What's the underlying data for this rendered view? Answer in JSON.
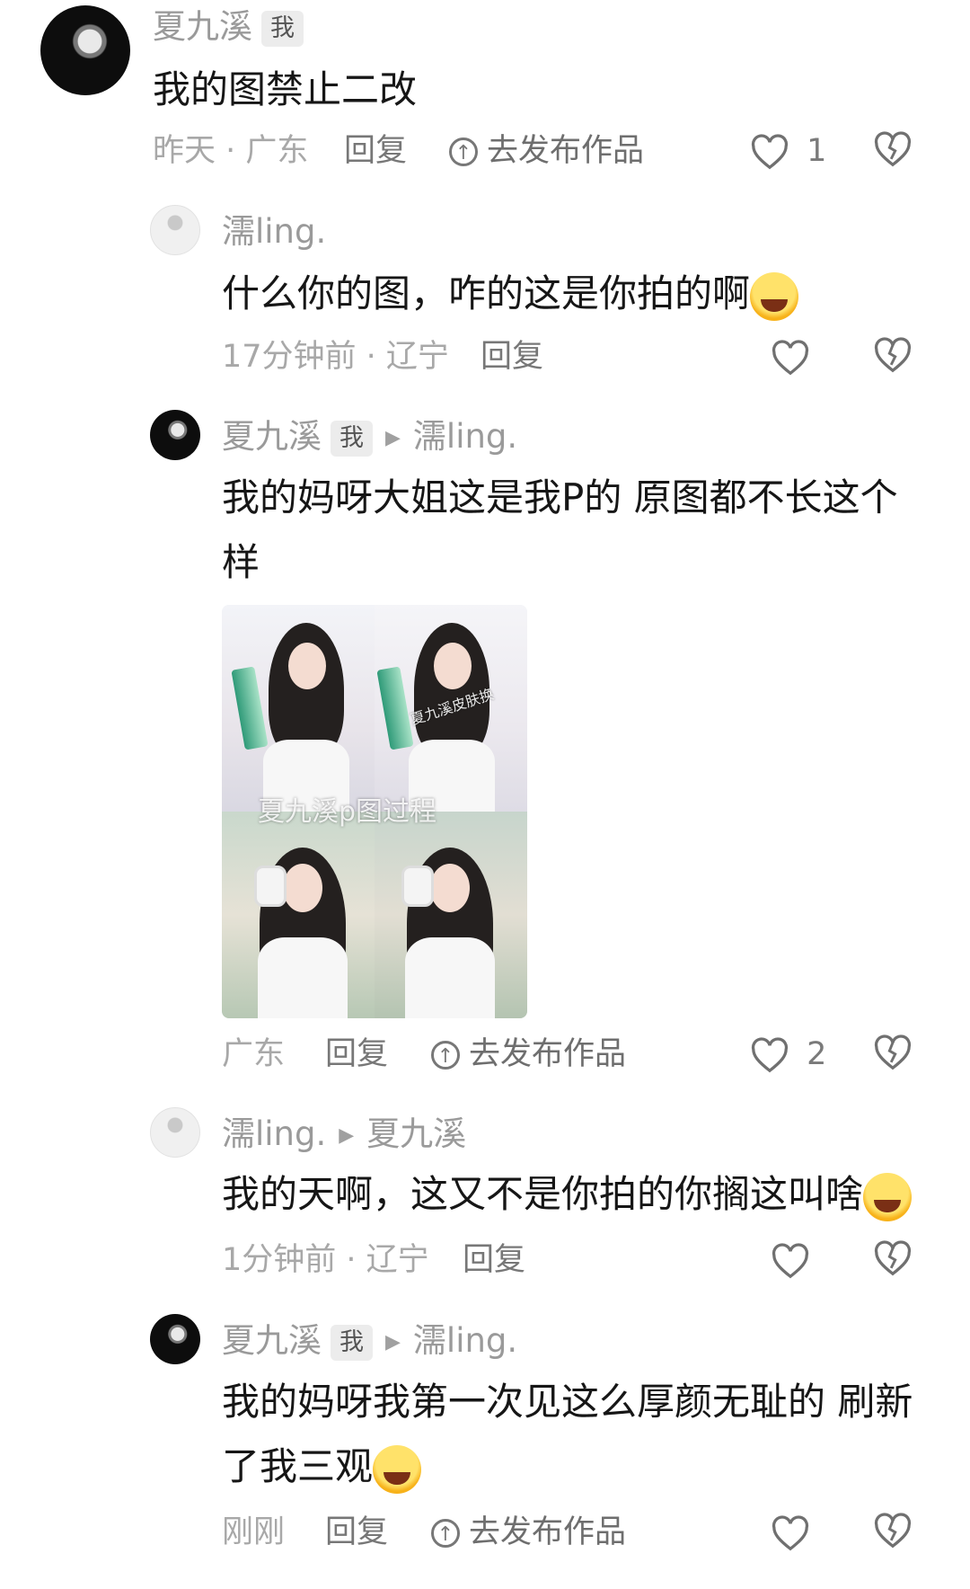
{
  "comments": [
    {
      "username": "夏九溪",
      "badge": "我",
      "text_lines": [
        "我的图禁止二改"
      ],
      "meta": "昨天 · 广东",
      "reply_label": "回复",
      "publish_label": "去发布作品",
      "like_count": "1"
    },
    {
      "username": "濡ling.",
      "text_lines": [
        "什么你的图，咋的这是你拍的啊"
      ],
      "meta": "17分钟前 · 辽宁",
      "reply_label": "回复",
      "emoji": "laughing-crying-emoji"
    },
    {
      "username": "夏九溪",
      "badge": "我",
      "reply_to": "濡ling.",
      "text_lines": [
        "我的妈呀大姐这是我P的 原图都不长这个",
        "样"
      ],
      "image": {
        "caption": "夏九溪p图过程",
        "small_text": "夏九溪皮肤换"
      },
      "meta": "广东",
      "reply_label": "回复",
      "publish_label": "去发布作品",
      "like_count": "2"
    },
    {
      "username": "濡ling.",
      "reply_to": "夏九溪",
      "text_lines": [
        "我的天啊，这又不是你拍的你搁这叫啥"
      ],
      "meta": "1分钟前 · 辽宁",
      "reply_label": "回复",
      "emoji": "rolling-laughing-emoji"
    },
    {
      "username": "夏九溪",
      "badge": "我",
      "reply_to": "濡ling.",
      "text_lines": [
        "我的妈呀我第一次见这么厚颜无耻的 刷新",
        "了我三观"
      ],
      "meta": "刚刚",
      "reply_label": "回复",
      "publish_label": "去发布作品",
      "emoji": "grinning-emoji"
    }
  ],
  "colors": {
    "text": "#161616",
    "muted": "#9a9a9a",
    "badge_bg": "#ececec"
  }
}
